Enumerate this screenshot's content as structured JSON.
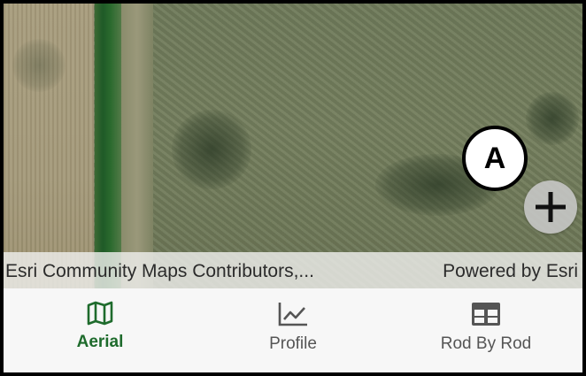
{
  "map": {
    "attribution_left": "Esri Community Maps Contributors,...",
    "attribution_right": "Powered by Esri"
  },
  "callout": {
    "label": "A"
  },
  "zoom": {
    "icon": "plus-icon"
  },
  "nav": {
    "items": [
      {
        "label": "Aerial",
        "icon": "map-icon",
        "active": true
      },
      {
        "label": "Profile",
        "icon": "line-chart-icon",
        "active": false
      },
      {
        "label": "Rod By Rod",
        "icon": "table-icon",
        "active": false
      }
    ]
  },
  "colors": {
    "accent": "#1e6b2c",
    "inactive": "#555555",
    "nav_background": "#f7f7f7"
  }
}
